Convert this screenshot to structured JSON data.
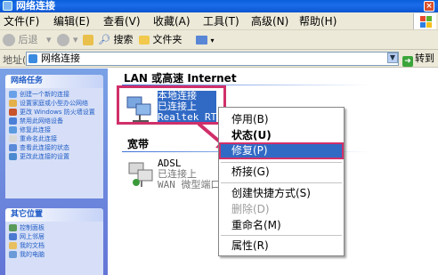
{
  "window": {
    "title": "网络连接"
  },
  "menubar": {
    "items": [
      "文件(F)",
      "编辑(E)",
      "查看(V)",
      "收藏(A)",
      "工具(T)",
      "高级(N)",
      "帮助(H)"
    ]
  },
  "toolbar": {
    "back_label": "后退",
    "search_label": "搜索",
    "folders_label": "文件夹"
  },
  "address": {
    "label": "地址(D)",
    "value": "网络连接",
    "go_label": "转到"
  },
  "leftpane": {
    "network_tasks_title": "网络任务",
    "network_tasks": [
      "创建一个新的连接",
      "设置家庭或小型办公网络",
      "更改 Windows 防火墙设置",
      "禁用此网络设备",
      "修复此连接",
      "重命名此连接",
      "查看此连接的状态",
      "更改此连接的设置"
    ],
    "other_places_title": "其它位置",
    "other_places": [
      "控制面板",
      "网上邻居",
      "我的文档",
      "我的电脑"
    ]
  },
  "content": {
    "lan_group_title": "LAN 或高速 Internet",
    "lan_connection": {
      "name": "本地连接",
      "status": "已连接上",
      "device": "Realtek RT"
    },
    "broadband_group_title": "宽带",
    "adsl_connection": {
      "name": "ADSL",
      "status": "已连接上",
      "device": "WAN 微型端口"
    }
  },
  "context_menu": {
    "items": [
      "停用(B)",
      "状态(U)",
      "修复(P)",
      "桥接(G)",
      "创建快捷方式(S)",
      "删除(D)",
      "重命名(M)",
      "属性(R)"
    ],
    "highlighted": "修复(P)",
    "bold": "状态(U)",
    "disabled": "删除(D)"
  },
  "colors": {
    "selection": "#316ac5",
    "annotation": "#d0306a",
    "titlebar": "#0a5fd8"
  }
}
